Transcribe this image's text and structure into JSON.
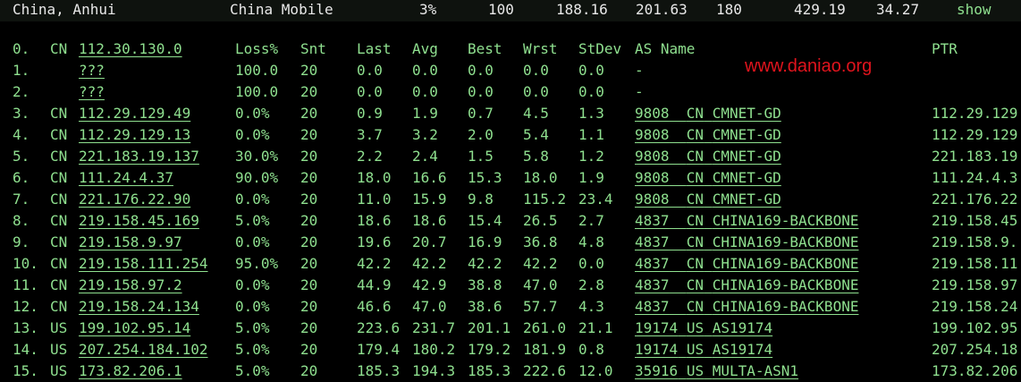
{
  "summary": {
    "location": "China, Anhui",
    "carrier": "China Mobile",
    "loss": "3%",
    "sent": "100",
    "last": "188.16",
    "avg": "201.63",
    "best": "180",
    "worst": "429.19",
    "stdev": "34.27",
    "link": "show"
  },
  "origin": {
    "index": "0.",
    "cc": "CN",
    "ip": "112.30.130.0"
  },
  "columns": {
    "loss": "Loss%",
    "snt": "Snt",
    "last": "Last",
    "avg": "Avg",
    "best": "Best",
    "wrst": "Wrst",
    "stdev": "StDev",
    "as_name": "AS Name",
    "ptr": "PTR"
  },
  "watermark": "www.daniao.org",
  "hops": [
    {
      "idx": "1.",
      "cc": "",
      "host": "???",
      "loss": "100.0",
      "snt": "20",
      "last": "0.0",
      "avg": "0.0",
      "best": "0.0",
      "wrst": "0.0",
      "stdev": "0.0",
      "asn": "-",
      "ascc": "",
      "asname": "",
      "ptr": ""
    },
    {
      "idx": "2.",
      "cc": "",
      "host": "???",
      "loss": "100.0",
      "snt": "20",
      "last": "0.0",
      "avg": "0.0",
      "best": "0.0",
      "wrst": "0.0",
      "stdev": "0.0",
      "asn": "-",
      "ascc": "",
      "asname": "",
      "ptr": ""
    },
    {
      "idx": "3.",
      "cc": "CN",
      "host": "112.29.129.49",
      "loss": "0.0%",
      "snt": "20",
      "last": "0.9",
      "avg": "1.9",
      "best": "0.7",
      "wrst": "4.5",
      "stdev": "1.3",
      "asn": "9808",
      "ascc": "CN",
      "asname": "CMNET-GD",
      "ptr": "112.29.129"
    },
    {
      "idx": "4.",
      "cc": "CN",
      "host": "112.29.129.13",
      "loss": "0.0%",
      "snt": "20",
      "last": "3.7",
      "avg": "3.2",
      "best": "2.0",
      "wrst": "5.4",
      "stdev": "1.1",
      "asn": "9808",
      "ascc": "CN",
      "asname": "CMNET-GD",
      "ptr": "112.29.129"
    },
    {
      "idx": "5.",
      "cc": "CN",
      "host": "221.183.19.137",
      "loss": "30.0%",
      "snt": "20",
      "last": "2.2",
      "avg": "2.4",
      "best": "1.5",
      "wrst": "5.8",
      "stdev": "1.2",
      "asn": "9808",
      "ascc": "CN",
      "asname": "CMNET-GD",
      "ptr": "221.183.19"
    },
    {
      "idx": "6.",
      "cc": "CN",
      "host": "111.24.4.37",
      "loss": "90.0%",
      "snt": "20",
      "last": "18.0",
      "avg": "16.6",
      "best": "15.3",
      "wrst": "18.0",
      "stdev": "1.9",
      "asn": "9808",
      "ascc": "CN",
      "asname": "CMNET-GD",
      "ptr": "111.24.4.3"
    },
    {
      "idx": "7.",
      "cc": "CN",
      "host": "221.176.22.90",
      "loss": "0.0%",
      "snt": "20",
      "last": "11.0",
      "avg": "15.9",
      "best": "9.8",
      "wrst": "115.2",
      "stdev": "23.4",
      "asn": "9808",
      "ascc": "CN",
      "asname": "CMNET-GD",
      "ptr": "221.176.22"
    },
    {
      "idx": "8.",
      "cc": "CN",
      "host": "219.158.45.169",
      "loss": "5.0%",
      "snt": "20",
      "last": "18.6",
      "avg": "18.6",
      "best": "15.4",
      "wrst": "26.5",
      "stdev": "2.7",
      "asn": "4837",
      "ascc": "CN",
      "asname": "CHINA169-BACKBONE",
      "ptr": "219.158.45"
    },
    {
      "idx": "9.",
      "cc": "CN",
      "host": "219.158.9.97",
      "loss": "0.0%",
      "snt": "20",
      "last": "19.6",
      "avg": "20.7",
      "best": "16.9",
      "wrst": "36.8",
      "stdev": "4.8",
      "asn": "4837",
      "ascc": "CN",
      "asname": "CHINA169-BACKBONE",
      "ptr": "219.158.9."
    },
    {
      "idx": "10.",
      "cc": "CN",
      "host": "219.158.111.254",
      "loss": "95.0%",
      "snt": "20",
      "last": "42.2",
      "avg": "42.2",
      "best": "42.2",
      "wrst": "42.2",
      "stdev": "0.0",
      "asn": "4837",
      "ascc": "CN",
      "asname": "CHINA169-BACKBONE",
      "ptr": "219.158.11"
    },
    {
      "idx": "11.",
      "cc": "CN",
      "host": "219.158.97.2",
      "loss": "0.0%",
      "snt": "20",
      "last": "44.9",
      "avg": "42.9",
      "best": "38.8",
      "wrst": "47.0",
      "stdev": "2.8",
      "asn": "4837",
      "ascc": "CN",
      "asname": "CHINA169-BACKBONE",
      "ptr": "219.158.97"
    },
    {
      "idx": "12.",
      "cc": "CN",
      "host": "219.158.24.134",
      "loss": "0.0%",
      "snt": "20",
      "last": "46.6",
      "avg": "47.0",
      "best": "38.6",
      "wrst": "57.7",
      "stdev": "4.3",
      "asn": "4837",
      "ascc": "CN",
      "asname": "CHINA169-BACKBONE",
      "ptr": "219.158.24"
    },
    {
      "idx": "13.",
      "cc": "US",
      "host": "199.102.95.14",
      "loss": "5.0%",
      "snt": "20",
      "last": "223.6",
      "avg": "231.7",
      "best": "201.1",
      "wrst": "261.0",
      "stdev": "21.1",
      "asn": "19174",
      "ascc": "US",
      "asname": "AS19174",
      "ptr": "199.102.95"
    },
    {
      "idx": "14.",
      "cc": "US",
      "host": "207.254.184.102",
      "loss": "5.0%",
      "snt": "20",
      "last": "179.4",
      "avg": "180.2",
      "best": "179.2",
      "wrst": "181.9",
      "stdev": "0.8",
      "asn": "19174",
      "ascc": "US",
      "asname": "AS19174",
      "ptr": "207.254.18"
    },
    {
      "idx": "15.",
      "cc": "US",
      "host": "173.82.206.1",
      "loss": "5.0%",
      "snt": "20",
      "last": "185.3",
      "avg": "194.3",
      "best": "185.3",
      "wrst": "222.6",
      "stdev": "12.0",
      "asn": "35916",
      "ascc": "US",
      "asname": "MULTA-ASN1",
      "ptr": "173.82.206"
    }
  ]
}
